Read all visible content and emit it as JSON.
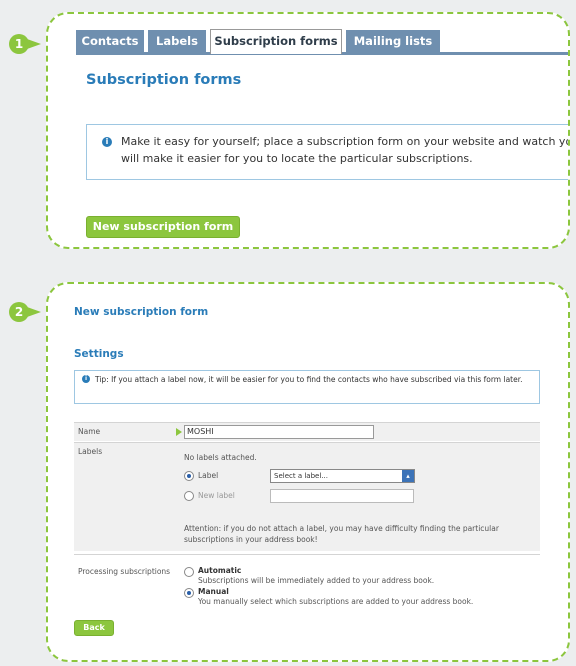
{
  "steps": [
    "1",
    "2"
  ],
  "panel1": {
    "tabs": [
      "Contacts",
      "Labels",
      "Subscription forms",
      "Mailing lists"
    ],
    "active_tab": "Subscription forms",
    "title": "Subscription forms",
    "info_text": "Make it easy for yourself; place a subscription form on your website and watch your ad will make it easier for you to locate the particular subscriptions.",
    "new_button": "New subscription form"
  },
  "panel2": {
    "title": "New subscription form",
    "settings_heading": "Settings",
    "info_text": "Tip: If you attach a label now, it will be easier for you to find the contacts who have subscribed via this form later.",
    "name_label": "Name",
    "name_value": "MOSHI",
    "labels_label": "Labels",
    "no_labels": "No labels attached.",
    "label_option": "Label",
    "label_select_value": "Select a label...",
    "new_label_option": "New label",
    "attention_text": "Attention: if you do not attach a label, you may have difficulty finding the particular subscriptions in your address book!",
    "processing_label": "Processing subscriptions",
    "automatic_title": "Automatic",
    "automatic_desc": "Subscriptions will be immediately added to your address book.",
    "manual_title": "Manual",
    "manual_desc": "You manually select which subscriptions are added to your address book.",
    "back_button": "Back"
  },
  "colors": {
    "accent_green": "#8cc63e",
    "title_blue": "#2a7cb8",
    "tab_blue": "#6f8faf"
  }
}
